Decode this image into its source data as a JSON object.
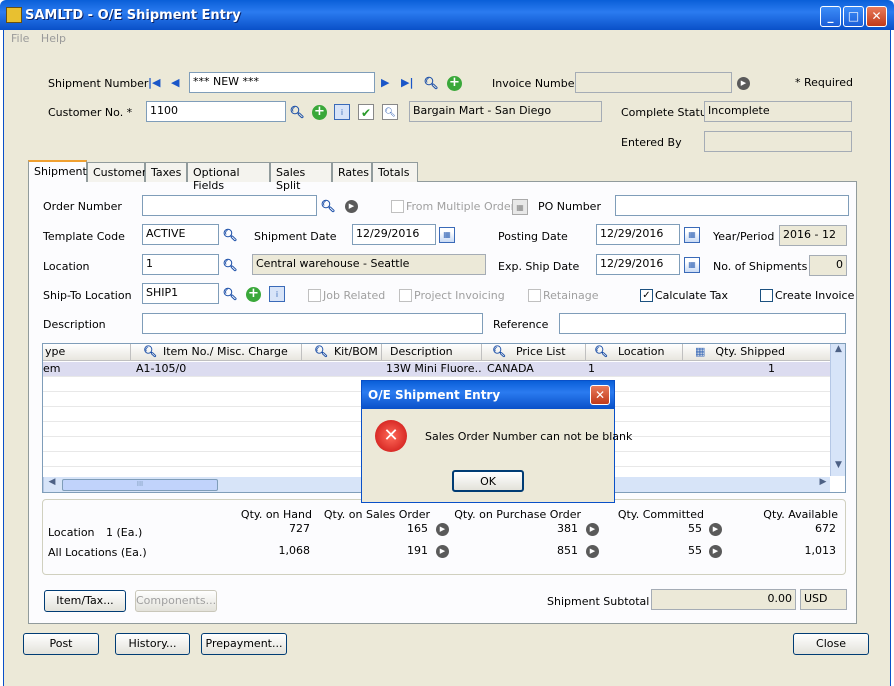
{
  "window": {
    "title": "SAMLTD - O/E Shipment Entry",
    "minimize": "_",
    "maximize": "□",
    "close": "✕"
  },
  "menu": [
    "File",
    "Help"
  ],
  "header": {
    "shipment_number_label": "Shipment Number",
    "shipment_number": "*** NEW ***",
    "invoice_number_label": "Invoice Number",
    "invoice_number": "",
    "required_label": "*  Required",
    "customer_no_label": "Customer No. *",
    "customer_no": "1100",
    "customer_name": "Bargain Mart - San Diego",
    "complete_status_label": "Complete Status",
    "complete_status": "Incomplete",
    "entered_by_label": "Entered By",
    "entered_by": ""
  },
  "tabs": [
    "Shipment",
    "Customer",
    "Taxes",
    "Optional Fields",
    "Sales Split",
    "Rates",
    "Totals"
  ],
  "form": {
    "order_number_label": "Order Number",
    "order_number": "",
    "from_multiple_orders_label": "From Multiple Orders",
    "po_number_label": "PO Number",
    "po_number": "",
    "template_code_label": "Template Code",
    "template_code": "ACTIVE",
    "shipment_date_label": "Shipment Date",
    "shipment_date": "12/29/2016",
    "posting_date_label": "Posting Date",
    "posting_date": "12/29/2016",
    "year_period_label": "Year/Period",
    "year_period": "2016 - 12",
    "location_label": "Location",
    "location": "1",
    "location_name": "Central warehouse - Seattle",
    "exp_ship_date_label": "Exp. Ship Date",
    "exp_ship_date": "12/29/2016",
    "no_shipments_label": "No. of Shipments",
    "no_shipments": "0",
    "ship_to_label": "Ship-To Location",
    "ship_to": "SHIP1",
    "job_related_label": "Job Related",
    "project_invoicing_label": "Project Invoicing",
    "retainage_label": "Retainage",
    "calculate_tax_label": "Calculate Tax",
    "create_invoice_label": "Create Invoice",
    "calculate_tax_checked": true,
    "create_invoice_checked": false,
    "description_label": "Description",
    "description": "",
    "reference_label": "Reference",
    "reference": ""
  },
  "grid": {
    "headers": [
      "ype",
      "Item No./ Misc. Charge",
      "Kit/BOM",
      "Description",
      "Price List",
      "Location",
      "Qty. Shipped"
    ],
    "rows": [
      [
        "em",
        "A1-105/0",
        "",
        "13W Mini Fluore...",
        "CANADA",
        "1",
        "1"
      ]
    ],
    "hscroll_label": "III"
  },
  "qty": {
    "headers": [
      "Qty. on Hand",
      "Qty. on Sales Order",
      "Qty. on Purchase Order",
      "Qty. Committed",
      "Qty. Available"
    ],
    "location_label": "Location",
    "location_ea": "1 (Ea.)",
    "location_values": [
      "727",
      "165",
      "381",
      "55",
      "672"
    ],
    "all_label": "All Locations (Ea.)",
    "all_values": [
      "1,068",
      "191",
      "851",
      "55",
      "1,013"
    ]
  },
  "buttons": {
    "item_tax": "Item/Tax...",
    "components": "Components...",
    "post": "Post",
    "history": "History...",
    "prepayment": "Prepayment...",
    "close": "Close"
  },
  "subtotal": {
    "label": "Shipment Subtotal",
    "value": "0.00",
    "currency": "USD"
  },
  "dialog": {
    "title": "O/E Shipment Entry",
    "message": "Sales Order Number can not be blank",
    "ok": "OK",
    "close": "✕"
  }
}
